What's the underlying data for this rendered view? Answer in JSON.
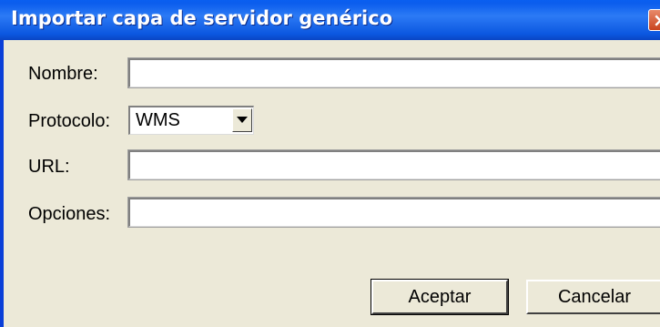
{
  "window": {
    "title": "Importar capa de servidor genérico"
  },
  "form": {
    "nombre": {
      "label": "Nombre:",
      "value": ""
    },
    "protocolo": {
      "label": "Protocolo:",
      "selected": "WMS"
    },
    "url": {
      "label": "URL:",
      "value": ""
    },
    "opciones": {
      "label": "Opciones:",
      "value": ""
    }
  },
  "buttons": {
    "accept": "Aceptar",
    "cancel": "Cancelar"
  },
  "colors": {
    "titlebar": "#0b5ded",
    "dialog_bg": "#ece9d8",
    "close_button": "#c9431f"
  },
  "icons": {
    "close": "close-icon",
    "dropdown": "chevron-down-icon"
  }
}
